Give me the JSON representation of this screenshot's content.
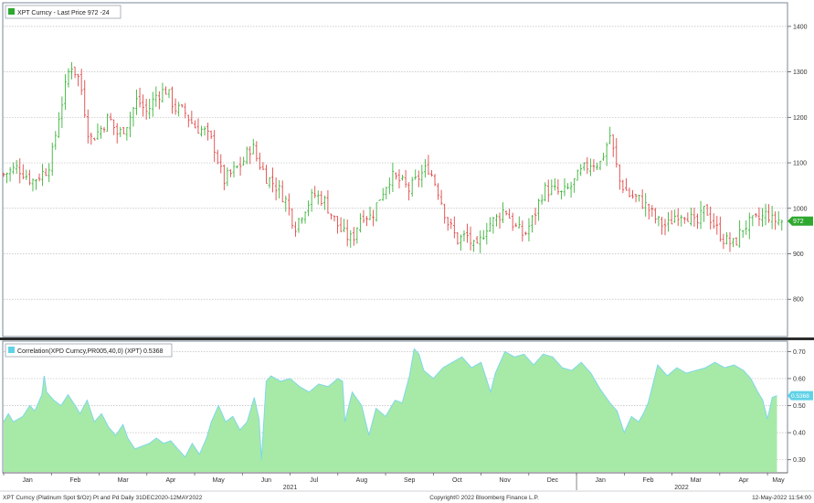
{
  "colors": {
    "frame_border": "#7a8a99",
    "grid": "#bdbdbd",
    "candle_up": "#3cb43c",
    "candle_down": "#e04848",
    "last_price_tag": "#2fa82f",
    "corr_fill": "#a7eaa7",
    "corr_line": "#7ed8e8",
    "corr_tag": "#5fd2e6",
    "legend_box_price": "#2fa82f",
    "legend_box_corr": "#5fd2e6"
  },
  "footer": {
    "left": "XPT Curncy (Platinum Spot  $/Oz) Pt and Pd  Daily 31DEC2020-12MAY2022",
    "center": "Copyright© 2022 Bloomberg Finance L.P.",
    "right": "12-May-2022 11:54:00"
  },
  "chart_data": [
    {
      "type": "candlestick",
      "legend": "XPT Curncy - Last Price 972  -24",
      "last_price_label": "972",
      "ylim": [
        720,
        1450
      ],
      "yticks": [
        800,
        900,
        1000,
        1100,
        1200,
        1300,
        1400
      ],
      "grid": "horizontal",
      "legend_placement": "top-left",
      "x_range": [
        0,
        16.4
      ],
      "close_series": {
        "t": [
          0,
          0.3,
          0.6,
          0.9,
          1.0,
          1.15,
          1.3,
          1.4,
          1.6,
          1.8,
          2.0,
          2.2,
          2.4,
          2.6,
          2.8,
          3.0,
          3.2,
          3.4,
          3.6,
          3.8,
          4.0,
          4.2,
          4.4,
          4.6,
          4.8,
          5.0,
          5.2,
          5.3,
          5.5,
          5.7,
          5.9,
          6.1,
          6.3,
          6.5,
          6.7,
          6.9,
          7.1,
          7.3,
          7.5,
          7.7,
          7.9,
          8.1,
          8.3,
          8.5,
          8.7,
          8.9,
          9.1,
          9.3,
          9.5,
          9.7,
          9.9,
          10.1,
          10.3,
          10.5,
          10.7,
          10.9,
          11.1,
          11.3,
          11.5,
          11.7,
          11.9,
          12.1,
          12.3,
          12.5,
          12.7,
          12.9,
          13.1,
          13.3,
          13.5,
          13.7,
          13.9,
          14.1,
          14.3,
          14.5,
          14.7,
          14.9,
          15.1,
          15.3,
          15.5,
          15.7,
          15.9,
          16.0,
          16.1,
          16.2,
          16.3
        ],
        "close": [
          1075,
          1090,
          1060,
          1085,
          1110,
          1200,
          1270,
          1320,
          1280,
          1150,
          1170,
          1200,
          1160,
          1190,
          1240,
          1210,
          1250,
          1260,
          1220,
          1210,
          1180,
          1170,
          1140,
          1060,
          1080,
          1100,
          1140,
          1110,
          1070,
          1050,
          1020,
          960,
          1000,
          1030,
          1020,
          980,
          945,
          930,
          990,
          980,
          1030,
          1070,
          1060,
          1040,
          1070,
          1090,
          1040,
          970,
          930,
          940,
          905,
          960,
          975,
          1000,
          960,
          940,
          980,
          1040,
          1040,
          1030,
          1050,
          1080,
          1100,
          1100,
          1160,
          1060,
          1030,
          1020,
          1000,
          970,
          960,
          990,
          990,
          960,
          1000,
          960,
          930,
          920,
          960,
          970,
          980,
          990,
          972,
          975,
          972
        ]
      }
    },
    {
      "type": "area",
      "legend": "Correlation(XPD Curncy,PR005,40,0) (XPT) 0.5368",
      "last_value_label": "0.5368",
      "ylim": [
        0.255,
        0.735
      ],
      "yticks": [
        0.3,
        0.4,
        0.5,
        0.6,
        0.7
      ],
      "yticklabels": [
        "0.30",
        "0.40",
        "0.50",
        "0.60",
        "0.70"
      ],
      "grid": "horizontal",
      "legend_placement": "top-left",
      "x_range": [
        0,
        16.4
      ],
      "x": [
        0,
        0.1,
        0.2,
        0.4,
        0.55,
        0.65,
        0.8,
        0.85,
        0.9,
        1.05,
        1.2,
        1.35,
        1.5,
        1.6,
        1.75,
        1.9,
        2.05,
        2.2,
        2.35,
        2.5,
        2.6,
        2.75,
        2.9,
        3.05,
        3.2,
        3.35,
        3.5,
        3.65,
        3.8,
        3.95,
        4.1,
        4.25,
        4.35,
        4.5,
        4.65,
        4.8,
        4.95,
        5.1,
        5.25,
        5.35,
        5.4,
        5.5,
        5.6,
        5.8,
        6.0,
        6.2,
        6.4,
        6.6,
        6.8,
        7.0,
        7.1,
        7.15,
        7.3,
        7.5,
        7.65,
        7.8,
        8.0,
        8.2,
        8.35,
        8.5,
        8.6,
        8.7,
        8.8,
        9.0,
        9.2,
        9.4,
        9.6,
        9.8,
        10.0,
        10.2,
        10.3,
        10.5,
        10.7,
        10.9,
        11.1,
        11.3,
        11.5,
        11.7,
        11.9,
        12.1,
        12.3,
        12.5,
        12.7,
        12.85,
        13.0,
        13.15,
        13.3,
        13.4,
        13.5,
        13.7,
        13.9,
        14.1,
        14.3,
        14.5,
        14.7,
        14.9,
        15.1,
        15.3,
        15.5,
        15.65,
        15.8,
        15.9,
        16.0,
        16.1,
        16.2
      ],
      "y": [
        0.44,
        0.47,
        0.44,
        0.46,
        0.5,
        0.48,
        0.54,
        0.61,
        0.55,
        0.52,
        0.5,
        0.54,
        0.5,
        0.47,
        0.52,
        0.44,
        0.47,
        0.42,
        0.39,
        0.43,
        0.38,
        0.34,
        0.35,
        0.36,
        0.38,
        0.36,
        0.37,
        0.34,
        0.31,
        0.36,
        0.32,
        0.38,
        0.44,
        0.5,
        0.44,
        0.46,
        0.41,
        0.44,
        0.53,
        0.45,
        0.3,
        0.59,
        0.61,
        0.59,
        0.6,
        0.57,
        0.55,
        0.58,
        0.57,
        0.6,
        0.59,
        0.44,
        0.55,
        0.5,
        0.39,
        0.49,
        0.46,
        0.52,
        0.51,
        0.61,
        0.71,
        0.69,
        0.63,
        0.6,
        0.64,
        0.66,
        0.68,
        0.64,
        0.66,
        0.55,
        0.62,
        0.7,
        0.68,
        0.69,
        0.65,
        0.69,
        0.68,
        0.64,
        0.63,
        0.66,
        0.62,
        0.56,
        0.51,
        0.48,
        0.4,
        0.46,
        0.44,
        0.47,
        0.51,
        0.65,
        0.61,
        0.64,
        0.62,
        0.63,
        0.64,
        0.66,
        0.64,
        0.65,
        0.63,
        0.6,
        0.55,
        0.52,
        0.45,
        0.53,
        0.537
      ]
    }
  ],
  "x_axis": {
    "months": [
      {
        "label": "Jan",
        "t": 0.5
      },
      {
        "label": "Feb",
        "t": 1.5
      },
      {
        "label": "Mar",
        "t": 2.5
      },
      {
        "label": "Apr",
        "t": 3.5
      },
      {
        "label": "May",
        "t": 4.5
      },
      {
        "label": "Jun",
        "t": 5.5
      },
      {
        "label": "Jul",
        "t": 6.5
      },
      {
        "label": "Aug",
        "t": 7.5
      },
      {
        "label": "Sep",
        "t": 8.5
      },
      {
        "label": "Oct",
        "t": 9.5
      },
      {
        "label": "Nov",
        "t": 10.5
      },
      {
        "label": "Dec",
        "t": 11.5
      },
      {
        "label": "Jan",
        "t": 12.5
      },
      {
        "label": "Feb",
        "t": 13.5
      },
      {
        "label": "Mar",
        "t": 14.5
      },
      {
        "label": "Apr",
        "t": 15.5
      },
      {
        "label": "May",
        "t": 16.5
      }
    ],
    "years": [
      {
        "label": "2021",
        "t": 6.0
      },
      {
        "label": "2022",
        "t": 14.2
      }
    ],
    "year_boundary_t": 12.0
  }
}
